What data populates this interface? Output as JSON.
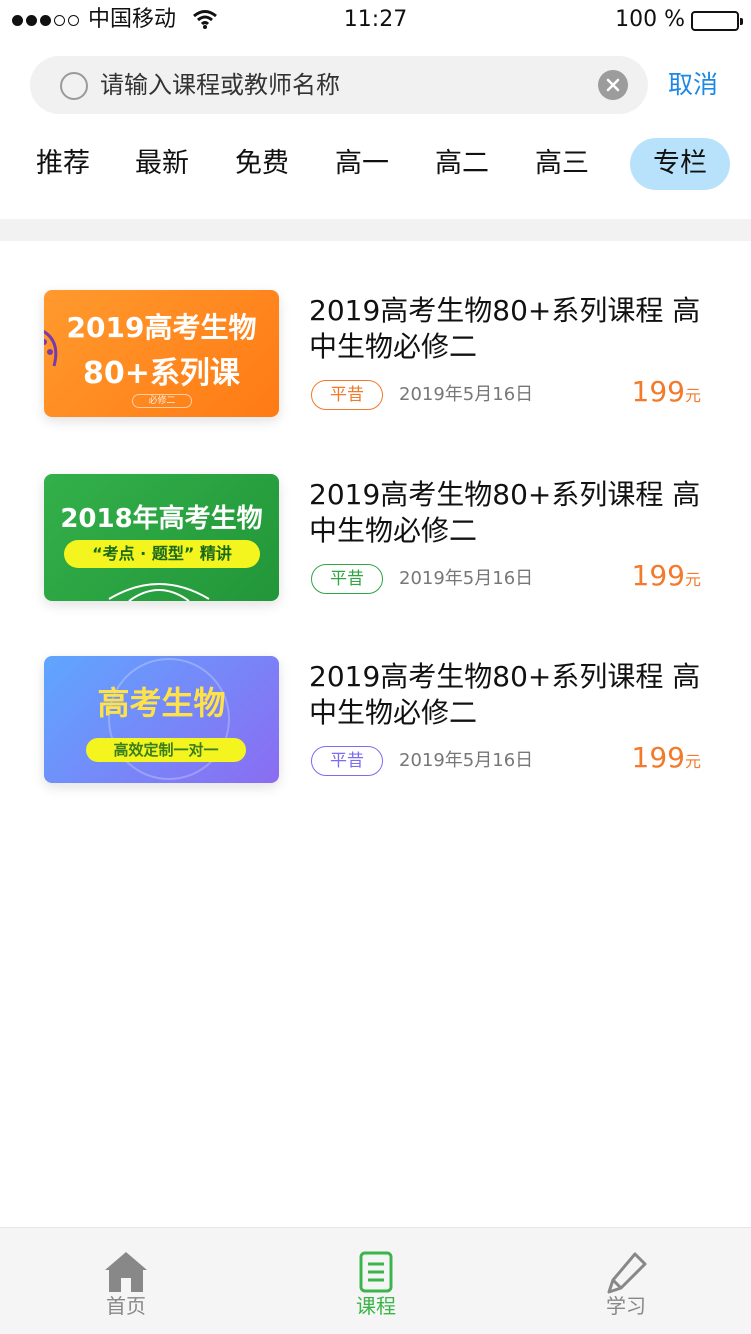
{
  "status_bar": {
    "carrier": "中国移动",
    "time": "11:27",
    "battery": "100 %"
  },
  "search": {
    "placeholder": "请输入课程或教师名称",
    "cancel_label": "取消"
  },
  "tabs": [
    {
      "label": "推荐",
      "active": false
    },
    {
      "label": "最新",
      "active": false
    },
    {
      "label": "免费",
      "active": false
    },
    {
      "label": "高一",
      "active": false
    },
    {
      "label": "高二",
      "active": false
    },
    {
      "label": "高三",
      "active": false
    },
    {
      "label": "专栏",
      "active": true
    }
  ],
  "courses": [
    {
      "thumb_line1": "2019高考生物",
      "thumb_line2": "80+系列课",
      "thumb_sub": "必修二",
      "title": "2019高考生物80+系列课程 高中生物必修二",
      "tag": "平昔",
      "date": "2019年5月16日",
      "price": "199",
      "unit": "元"
    },
    {
      "thumb_line1": "2018年高考生物",
      "thumb_pill": "“考点 · 题型” 精讲",
      "title": "2019高考生物80+系列课程 高中生物必修二",
      "tag": "平昔",
      "date": "2019年5月16日",
      "price": "199",
      "unit": "元"
    },
    {
      "thumb_line1": "高考生物",
      "thumb_pill": "高效定制一对一",
      "title": "2019高考生物80+系列课程 高中生物必修二",
      "tag": "平昔",
      "date": "2019年5月16日",
      "price": "199",
      "unit": "元"
    }
  ],
  "bottom_nav": [
    {
      "label": "首页",
      "icon": "home-icon",
      "active": false
    },
    {
      "label": "课程",
      "icon": "course-icon",
      "active": true
    },
    {
      "label": "学习",
      "icon": "pencil-icon",
      "active": false
    }
  ],
  "colors": {
    "accent": "#1e88e5",
    "price": "#f27a2a",
    "active_tab_bg": "#b8e2fb",
    "nav_active": "#3bb54a"
  }
}
